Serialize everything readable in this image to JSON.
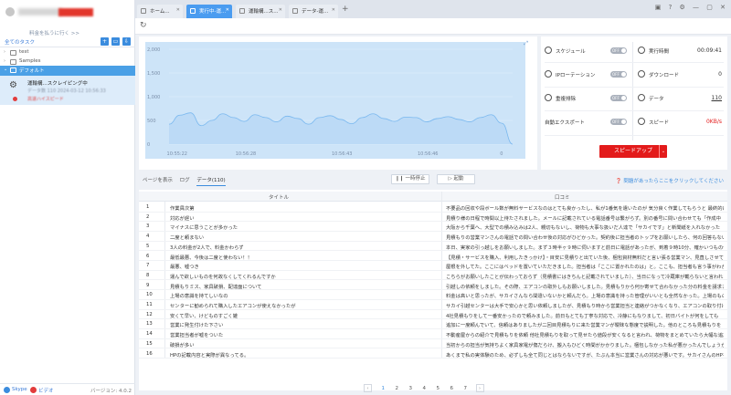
{
  "sidebar": {
    "plan_link": "料金を払うに行く >>",
    "section_title": "全てのタスク",
    "tree": [
      {
        "label": "test",
        "selected": false
      },
      {
        "label": "Samples",
        "selected": false
      },
      {
        "label": "デフォルト",
        "selected": true
      }
    ],
    "task": {
      "name": "運輸構...スクレイピング中",
      "meta": "データ数 110  2024-03-12 10:56:33",
      "status": "高速ハイスピード"
    },
    "footer": {
      "left": "Skype",
      "right": "ビデオ",
      "version": "バージョン: 4.0.2"
    }
  },
  "tabs": [
    {
      "label": "ホーム..."
    },
    {
      "label": "実行中-運..."
    },
    {
      "label": "運輸構...ス..."
    },
    {
      "label": "データ-運..."
    }
  ],
  "chart_data": {
    "type": "area",
    "x_ticks": [
      "10:55:22",
      "10:56:28",
      "10:56:43",
      "10:56:46",
      "0"
    ],
    "y_ticks": [
      "2,000",
      "1,500",
      "1,000",
      "500",
      "0"
    ],
    "ylim": [
      0,
      2000
    ],
    "color": "#7ab8ef",
    "fill": "#bcdaf6",
    "series": [
      {
        "values": [
          420,
          610,
          660,
          390,
          500,
          640,
          560,
          480,
          620,
          560,
          470,
          590,
          540,
          420,
          560,
          600,
          520,
          430,
          560,
          640,
          540,
          480,
          570,
          560,
          470,
          540,
          580,
          520,
          470,
          560,
          620,
          440,
          0
        ]
      }
    ]
  },
  "stats": {
    "schedule_label": "スケジュール",
    "schedule_toggle": "OFF",
    "runtime_label": "実行時間",
    "runtime_value": "00:09:41",
    "ip_label": "IPローテーション",
    "ip_toggle": "OFF",
    "download_label": "ダウンロード",
    "download_value": "0",
    "dedupe_label": "重複排除",
    "dedupe_toggle": "OFF",
    "data_label": "データ",
    "data_value": "110",
    "export_label": "自動エクスポート",
    "export_toggle": "OFF",
    "speed_label": "スピード",
    "speed_value": "0KB/s",
    "speedup_button": "スピードアップ"
  },
  "bottom": {
    "subtabs": [
      "ページを表示",
      "ログ",
      "データ(110)"
    ],
    "pause_button": "一時停止",
    "start_button": "起動",
    "help_link": "問題があったらここをクリックしてください",
    "col_title": "タイトル",
    "col_review": "口コミ",
    "rows": [
      {
        "n": "1",
        "title": "作業員次第",
        "review": "不要品の回収や段ボール数が無料サービスなのはとても良かったし、私が1番気を遣いたのが 気分良く作業してもらうと 最終的に"
      },
      {
        "n": "2",
        "title": "対応が遅い",
        "review": "見積り様の日程で時間以上待たされました。メールに記載されている電話番号は繋がらず。別の番号に問い合わせても「作成中"
      },
      {
        "n": "3",
        "title": "マイナスに思うことが多かった",
        "review": "大阪から千葉へ、大型での積み込みは2人、親切もないし、荷物も大事な扱いだ人達で「サカイです」と新聞紙を入れなかった"
      },
      {
        "n": "4",
        "title": "二度と頼まない",
        "review": "見積もりの営業マンさんの電話での問い合わせ後の対応がひどかった。契約後に担当者のトップをお願いしたら、何の回答もない。"
      },
      {
        "n": "5",
        "title": "3人の料金が2人で、料金かわらず",
        "review": "本日、実家の引っ越しをお願いしました。まず３時半ヶ９時に伺いますと前日に電話があったが、到着９時10分、確かいつもの作業員"
      },
      {
        "n": "6",
        "title": "最低最悪、今後は二度と使わない！！",
        "review": "【見積・サービスを購入、利用したきっかけ】・目安に見積りと出ていた後、梱包資材無料だと言い張る営業マン、見直しさせて"
      },
      {
        "n": "7",
        "title": "最悪、嘘つき",
        "review": "屋根を外してた。ここにはベッドを置いていただきました。担当者は「ここに置かれたのは」と。ここも、担当者も言う事がわかりません"
      },
      {
        "n": "8",
        "title": "運んで欲しいものを何故なくしてくれるんですか",
        "review": "こちらがお願いしたことが伝わっておらず（見積書にはきちんと記載されていました）、当日になって冷蔵庫が載らないと言われた"
      },
      {
        "n": "9",
        "title": "見積もりミス、家具破損、配達面について",
        "review": "引越しの依頼をしました。その際、エアコンの取外しもお願いしました。見積もりから何か寄せて合わなかった分の料金を請求されました"
      },
      {
        "n": "10",
        "title": "上場の意識を持てしいなの",
        "review": "料金は高いと思ったが、サカイさんなら間違いないかと頼んだら。上場の意識を持った管理がいいとも全然なかった。上場のものは"
      },
      {
        "n": "11",
        "title": "センターに勧められて購入したエアコンが使えなかったが",
        "review": "サカイ引越センターは大手で安心かと思い依頼しましたが、見積もり時から営業担当と連絡がつかなくなり、エアコンの取り付けを"
      },
      {
        "n": "12",
        "title": "安くて早い、けどものすごく雑",
        "review": "4社見積もりをして一番安かったので頼みました。前日もとても丁寧な対応で、冷静にもなりまして、初日バイトが何をしても"
      },
      {
        "n": "13",
        "title": "営業に発生付けた下さい",
        "review": "追加に一度頼んでいて、信頼はありましたが二回目見積もりに来た営業マンが曖昧な態度で説明した。他のところも見積もりを"
      },
      {
        "n": "14",
        "title": "営業担当者が嘘をついた",
        "review": "不動産屋からの紹介で見積もりを依頼 他社見積もりを取って見せたら値段が安くなると言われ、荷物をまとめていたら大幅な追加料金が"
      },
      {
        "n": "15",
        "title": "破損が多い",
        "review": "当初からの担当が気持ちよく家具家電が傷だらけ、搬入もひどく時間がかかりました。梱包しなかった私が悪かったんでしょうか"
      },
      {
        "n": "16",
        "title": "HPの記載内容と実際が異なってる。",
        "review": "あくまで私の実体験のため、必ずしも全て同じとはならないですが、たぶん本当に営業さんの対応が悪いです。サカイさんのHPを見た限りでは"
      }
    ],
    "pages": [
      "1",
      "2",
      "3",
      "4",
      "5",
      "6",
      "7"
    ],
    "active_page": "1"
  }
}
